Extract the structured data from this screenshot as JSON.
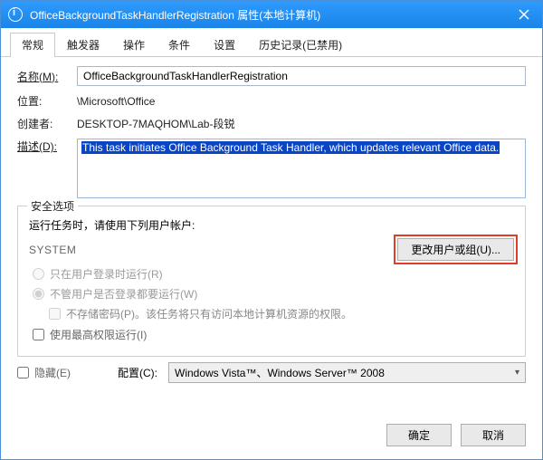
{
  "titlebar": {
    "title": "OfficeBackgroundTaskHandlerRegistration 属性(本地计算机)"
  },
  "tabs": [
    {
      "label": "常规",
      "active": true
    },
    {
      "label": "触发器",
      "active": false
    },
    {
      "label": "操作",
      "active": false
    },
    {
      "label": "条件",
      "active": false
    },
    {
      "label": "设置",
      "active": false
    },
    {
      "label": "历史记录(已禁用)",
      "active": false
    }
  ],
  "general": {
    "name_label": "名称(M):",
    "name_value": "OfficeBackgroundTaskHandlerRegistration",
    "location_label": "位置:",
    "location_value": "\\Microsoft\\Office",
    "author_label": "创建者:",
    "author_value": "DESKTOP-7MAQHOM\\Lab-段锐",
    "desc_label": "描述(D):",
    "desc_value": "This task initiates Office Background Task Handler, which updates relevant Office data."
  },
  "security": {
    "legend": "安全选项",
    "run_as_label": "运行任务时，请使用下列用户帐户:",
    "account": "SYSTEM",
    "change_user_btn": "更改用户或组(U)...",
    "radio_logged_on": "只在用户登录时运行(R)",
    "radio_any": "不管用户是否登录都要运行(W)",
    "store_pw": "不存储密码(P)。该任务将只有访问本地计算机资源的权限。",
    "highest_priv": "使用最高权限运行(I)"
  },
  "footer": {
    "hidden_label": "隐藏(E)",
    "config_label": "配置(C):",
    "combo_value": "Windows Vista™、Windows Server™ 2008"
  },
  "buttons": {
    "ok": "确定",
    "cancel": "取消"
  }
}
